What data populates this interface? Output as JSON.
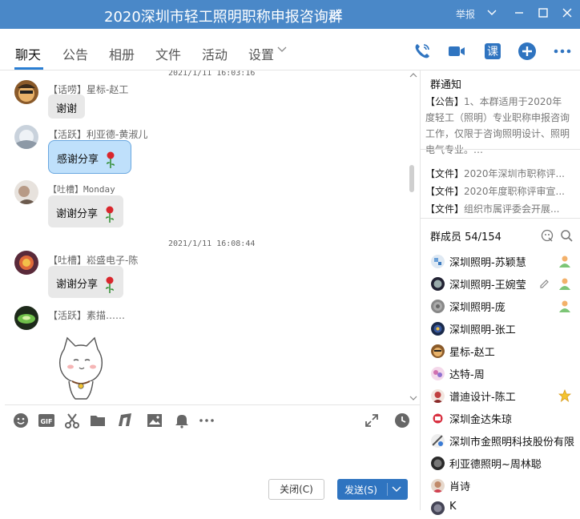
{
  "window": {
    "title": "2020深圳市轻工照明职称申报咨询群",
    "report_label": "举报",
    "minimize_icon": "minimize-icon",
    "maximize_icon": "maximize-icon",
    "close_icon": "close-icon",
    "accent_color": "#4a88c8"
  },
  "tabs": [
    {
      "label": "聊天",
      "active": true
    },
    {
      "label": "公告"
    },
    {
      "label": "相册"
    },
    {
      "label": "文件"
    },
    {
      "label": "活动"
    },
    {
      "label": "设置"
    }
  ],
  "toolbar_icons": [
    "phone-call-icon",
    "video-call-icon",
    "course-icon",
    "add-icon",
    "more-icon"
  ],
  "toolbar": {
    "course_label": "课"
  },
  "chat": {
    "timestamps": [
      "2021/1/11 16:03:16",
      "2021/1/11 16:08:44"
    ],
    "messages": [
      {
        "sender": "【话唠】星标-赵工",
        "text": "谢谢",
        "emoji": ""
      },
      {
        "sender": "【活跃】利亚德-黄淑儿",
        "text": "感谢分享",
        "emoji": "rose"
      },
      {
        "sender": "【吐槽】Monday",
        "text": "谢谢分享",
        "emoji": "rose"
      },
      {
        "sender": "【吐槽】崧盛电子-陈",
        "text": "谢谢分享",
        "emoji": "rose"
      },
      {
        "sender": "【活跃】素描……",
        "text": "",
        "emoji": "cat-sticker"
      }
    ]
  },
  "input": {
    "tool_icons": [
      "emoji-icon",
      "gif-icon",
      "scissors-icon",
      "folder-icon",
      "music-icon",
      "image-icon",
      "bell-icon",
      "more-icon",
      "expand-icon",
      "history-icon"
    ],
    "gif_label": "GIF",
    "close_button": "关闭(C)",
    "send_button": "发送(S)"
  },
  "notice": {
    "title": "群通知",
    "tag": "【公告】",
    "text": "1、本群适用于2020年度轻工（照明）专业职称申报咨询工作，仅限于咨询照明设计、照明电气专业。…"
  },
  "files": [
    {
      "tag": "【文件】",
      "name": "2020年深圳市职称评..."
    },
    {
      "tag": "【文件】",
      "name": "2020年度职称评审宣..."
    },
    {
      "tag": "【文件】",
      "name": "组织市属评委会开展..."
    }
  ],
  "members_header": {
    "title": "群成员 54/154",
    "icons": [
      "face-manage-icon",
      "search-icon"
    ]
  },
  "members": [
    {
      "name": "深圳照明-苏颖慧",
      "badge": "admin-icon"
    },
    {
      "name": "深圳照明-王婉莹",
      "badge": "admin-icon"
    },
    {
      "name": "深圳照明-庞",
      "badge": "admin-icon"
    },
    {
      "name": "深圳照明-张工",
      "badge": ""
    },
    {
      "name": "星标-赵工",
      "badge": ""
    },
    {
      "name": "达特-周",
      "badge": ""
    },
    {
      "name": "谱迪设计-陈工",
      "badge": "star-icon"
    },
    {
      "name": "深圳金达朱琼",
      "badge": ""
    },
    {
      "name": "深圳市金照明科技股份有限公司",
      "badge": ""
    },
    {
      "name": "利亚德照明~周林聪",
      "badge": ""
    },
    {
      "name": "肖诗",
      "badge": ""
    },
    {
      "name": "K",
      "badge": ""
    }
  ]
}
